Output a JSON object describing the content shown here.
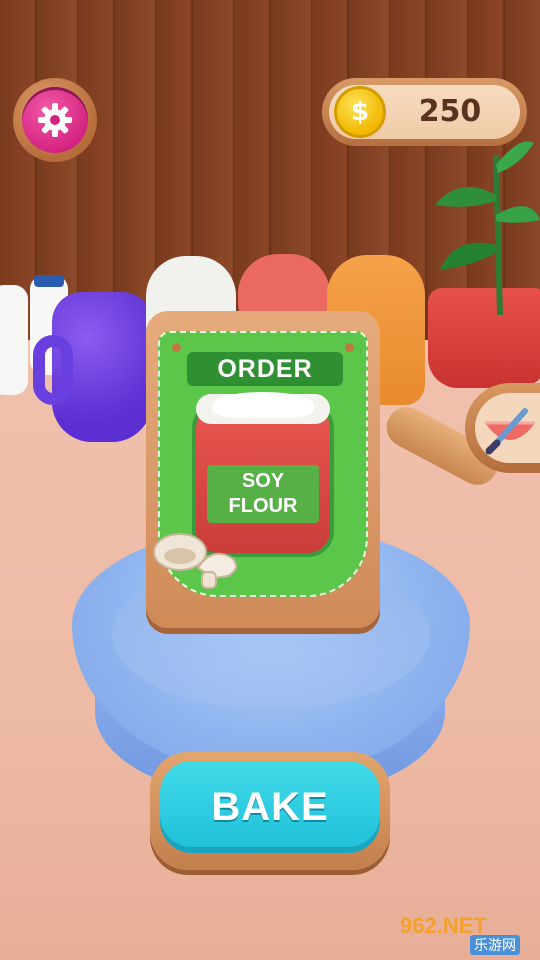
{
  "hud": {
    "settings_icon": "gear-icon",
    "coins": "250",
    "coin_symbol": "$"
  },
  "order_card": {
    "title": "ORDER",
    "ingredient_line1": "SOY",
    "ingredient_line2": "FLOUR",
    "garnish_icon": "mushroom-icon"
  },
  "actions": {
    "bake_label": "BAKE",
    "tool_icon": "knife-bowl-icon"
  },
  "watermark": {
    "brand": "962.NET",
    "subtitle": "乐游网"
  },
  "colors": {
    "accent_pink": "#e13a92",
    "coin_gold": "#f5c400",
    "order_green": "#5cc64a",
    "bake_cyan": "#29cde2"
  }
}
